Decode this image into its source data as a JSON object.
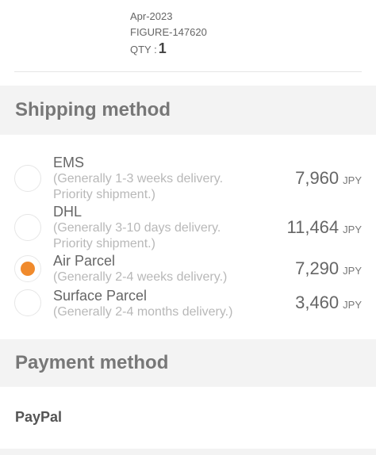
{
  "product": {
    "date": "Apr-2023",
    "code": "FIGURE-147620",
    "qty_label": "QTY :",
    "qty_value": "1"
  },
  "shipping": {
    "title": "Shipping method",
    "options": [
      {
        "name": "EMS",
        "desc_line1": "(Generally 1-3 weeks delivery.",
        "desc_line2": "Priority shipment.)",
        "price": "7,960",
        "currency": "JPY",
        "selected": false
      },
      {
        "name": "DHL",
        "desc_line1": "(Generally 3-10 days delivery.",
        "desc_line2": "Priority shipment.)",
        "price": "11,464",
        "currency": "JPY",
        "selected": false
      },
      {
        "name": "Air Parcel",
        "desc_line1": "(Generally 2-4 weeks delivery.)",
        "desc_line2": "",
        "price": "7,290",
        "currency": "JPY",
        "selected": true
      },
      {
        "name": "Surface Parcel",
        "desc_line1": "(Generally 2-4 months delivery.)",
        "desc_line2": "",
        "price": "3,460",
        "currency": "JPY",
        "selected": false
      }
    ]
  },
  "payment": {
    "title": "Payment method",
    "paypal_label": "PayPal"
  },
  "colors": {
    "accent": "#f08a2c",
    "section_bg": "#f3f3f3"
  }
}
